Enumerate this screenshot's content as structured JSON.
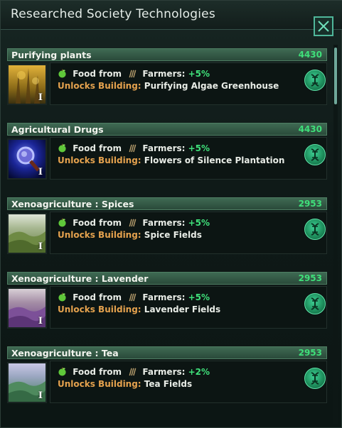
{
  "window": {
    "title": "Researched Society Technologies"
  },
  "entries": [
    {
      "name": "Purifying plants",
      "cost": "4430",
      "food_label": "Food from",
      "farmers_label": "Farmers:",
      "modifier": "+5%",
      "unlocks_label": "Unlocks Building:",
      "unlocks_value": "Purifying Algae Greenhouse",
      "tier": "I",
      "icon": "purifying-plants-icon"
    },
    {
      "name": "Agricultural Drugs",
      "cost": "4430",
      "food_label": "Food from",
      "farmers_label": "Farmers:",
      "modifier": "+5%",
      "unlocks_label": "Unlocks Building:",
      "unlocks_value": "Flowers of Silence Plantation",
      "tier": "I",
      "icon": "agricultural-drugs-icon"
    },
    {
      "name": "Xenoagriculture : Spices",
      "cost": "2953",
      "food_label": "Food from",
      "farmers_label": "Farmers:",
      "modifier": "+5%",
      "unlocks_label": "Unlocks Building:",
      "unlocks_value": "Spice Fields",
      "tier": "I",
      "icon": "spice-fields-icon"
    },
    {
      "name": "Xenoagriculture : Lavender",
      "cost": "2953",
      "food_label": "Food from",
      "farmers_label": "Farmers:",
      "modifier": "+5%",
      "unlocks_label": "Unlocks Building:",
      "unlocks_value": "Lavender Fields",
      "tier": "I",
      "icon": "lavender-fields-icon"
    },
    {
      "name": "Xenoagriculture : Tea",
      "cost": "2953",
      "food_label": "Food from",
      "farmers_label": "Farmers:",
      "modifier": "+2%",
      "unlocks_label": "Unlocks Building:",
      "unlocks_value": "Tea Fields",
      "tier": "I",
      "icon": "tea-fields-icon"
    }
  ],
  "colors": {
    "cost": "#3fe07a",
    "unlocks_label": "#e5a24e",
    "header": "#3f6a53",
    "accent": "#4fb79a"
  }
}
